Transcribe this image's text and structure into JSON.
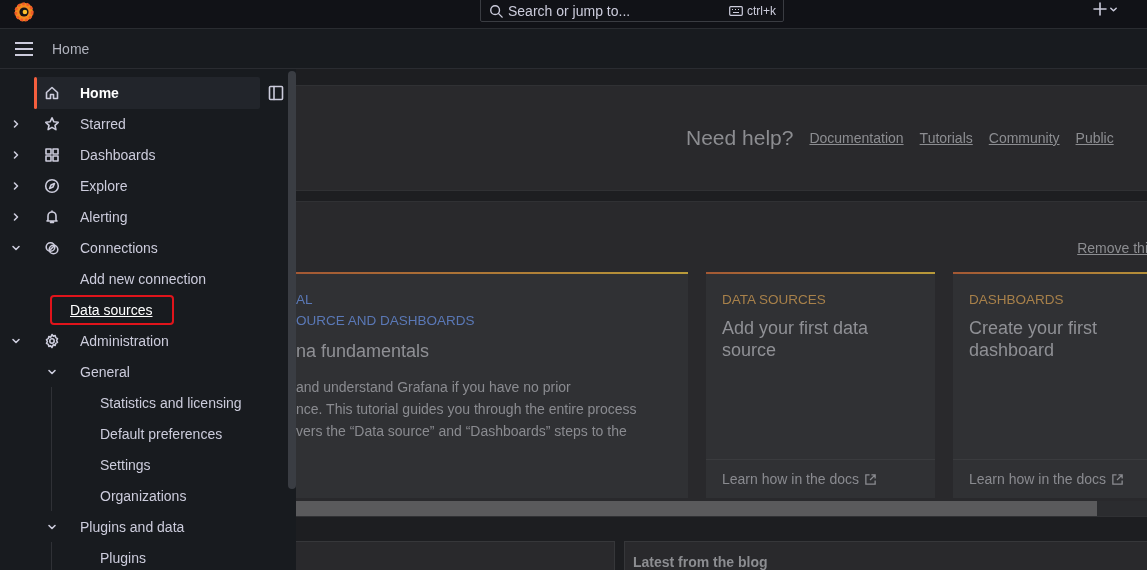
{
  "topbar": {
    "search": {
      "placeholder": "Search or jump to..."
    },
    "shortcut": "ctrl+k"
  },
  "breadcrumb": "Home",
  "nav": [
    {
      "label": "Home",
      "selected": true
    },
    {
      "label": "Starred",
      "selected": false,
      "expanded": false
    },
    {
      "label": "Dashboards",
      "selected": false,
      "expanded": false
    },
    {
      "label": "Explore",
      "selected": false,
      "expanded": false
    },
    {
      "label": "Alerting",
      "selected": false,
      "expanded": false
    },
    {
      "label": "Connections",
      "selected": false,
      "expanded": true,
      "children": [
        {
          "label": "Add new connection",
          "selected": false,
          "highlighted": false
        },
        {
          "label": "Data sources",
          "selected": false,
          "highlighted": true
        }
      ]
    },
    {
      "label": "Administration",
      "selected": false,
      "expanded": true,
      "children": [
        {
          "label": "General",
          "selected": false,
          "expanded": true,
          "children": [
            {
              "label": "Statistics and licensing",
              "selected": false
            },
            {
              "label": "Default preferences",
              "selected": false
            },
            {
              "label": "Settings",
              "selected": false
            },
            {
              "label": "Organizations",
              "selected": false
            }
          ]
        },
        {
          "label": "Plugins and data",
          "selected": false,
          "expanded": true,
          "children": [
            {
              "label": "Plugins",
              "selected": false
            }
          ]
        }
      ]
    }
  ],
  "help": {
    "title": "Need help?",
    "links": [
      "Documentation",
      "Tutorials",
      "Community",
      "Public"
    ]
  },
  "remove_link": "Remove thi",
  "cards": [
    {
      "kind": "tutorial",
      "labels": [
        "AL",
        "OURCE AND DASHBOARDS"
      ],
      "title": "na fundamentals",
      "body": "and understand Grafana if you have no prior\nnce. This tutorial guides you through the entire process\nvers the “Data source” and “Dashboards” steps to the"
    },
    {
      "kind": "task",
      "label": "DATA SOURCES",
      "title": "Add your first data source",
      "link": "Learn how in the docs"
    },
    {
      "kind": "task",
      "label": "DASHBOARDS",
      "title": "Create your first dashboard",
      "link": "Learn how in the docs"
    }
  ],
  "blog": {
    "title": "Latest from the blog"
  }
}
